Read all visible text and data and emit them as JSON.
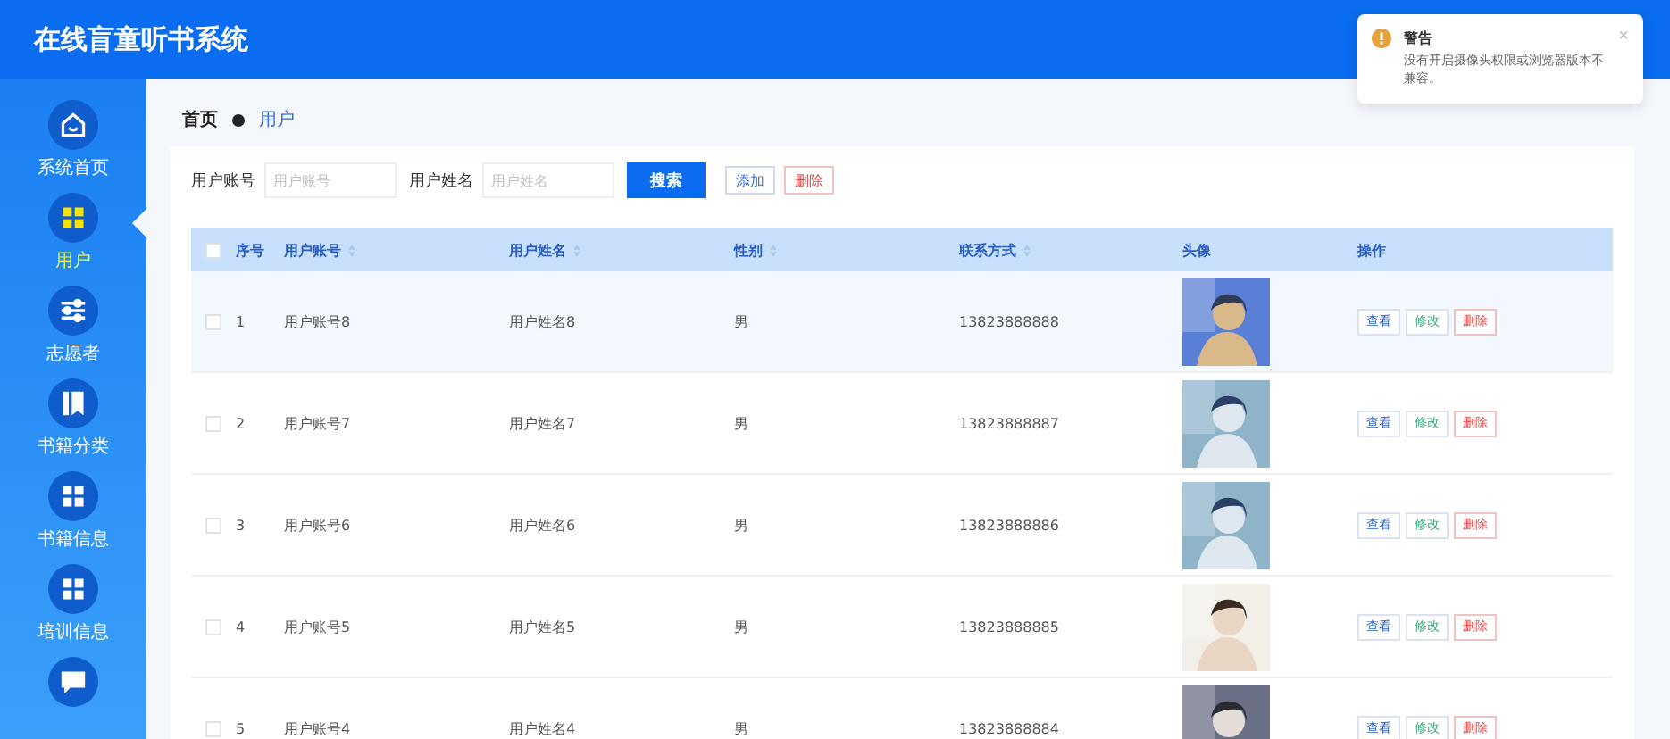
{
  "header": {
    "title": "在线盲童听书系统"
  },
  "sidebar": {
    "items": [
      {
        "label": "系统首页",
        "kind": "home",
        "selected": false
      },
      {
        "label": "用户",
        "kind": "grid",
        "selected": true
      },
      {
        "label": "志愿者",
        "kind": "sliders",
        "selected": false
      },
      {
        "label": "书籍分类",
        "kind": "book",
        "selected": false
      },
      {
        "label": "书籍信息",
        "kind": "grid",
        "selected": false
      },
      {
        "label": "培训信息",
        "kind": "grid",
        "selected": false
      },
      {
        "kind": "chat",
        "selected": false
      }
    ]
  },
  "breadcrumb": [
    "首页",
    "用户"
  ],
  "search": {
    "fields": [
      {
        "label": "用户账号",
        "placeholder": "用户账号"
      },
      {
        "label": "用户姓名",
        "placeholder": "用户姓名"
      }
    ],
    "search_button": "搜索",
    "add_button": "添加",
    "delete_button": "删除"
  },
  "table": {
    "all_checked": false,
    "columns": [
      {
        "label": "序号",
        "sortable": false
      },
      {
        "label": "用户账号",
        "sortable": true
      },
      {
        "label": "用户姓名",
        "sortable": true
      },
      {
        "label": "性别",
        "sortable": true
      },
      {
        "label": "联系方式",
        "sortable": true
      },
      {
        "label": "头像",
        "sortable": false
      },
      {
        "label": "操作",
        "sortable": false
      }
    ],
    "rows": [
      {
        "no": "1",
        "account": "用户账号8",
        "name": "用户姓名8",
        "gender": "男",
        "phone": "13823888888",
        "checked": false,
        "hovered": true,
        "actions": [
          "查看",
          "修改",
          "删除"
        ]
      },
      {
        "no": "2",
        "account": "用户账号7",
        "name": "用户姓名7",
        "gender": "男",
        "phone": "13823888887",
        "checked": false,
        "hovered": false,
        "actions": [
          "查看",
          "修改",
          "删除"
        ]
      },
      {
        "no": "3",
        "account": "用户账号6",
        "name": "用户姓名6",
        "gender": "男",
        "phone": "13823888886",
        "checked": false,
        "hovered": false,
        "actions": [
          "查看",
          "修改",
          "删除"
        ]
      },
      {
        "no": "4",
        "account": "用户账号5",
        "name": "用户姓名5",
        "gender": "男",
        "phone": "13823888885",
        "checked": false,
        "hovered": false,
        "actions": [
          "查看",
          "修改",
          "删除"
        ]
      },
      {
        "no": "5",
        "account": "用户账号4",
        "name": "用户姓名4",
        "gender": "男",
        "phone": "13823888884",
        "checked": false,
        "hovered": false,
        "actions": [
          "查看",
          "修改",
          "删除"
        ]
      }
    ]
  },
  "notification": {
    "title": "警告",
    "message": "没有开启摄像头权限或浏览器版本不兼容。",
    "close": "×"
  }
}
